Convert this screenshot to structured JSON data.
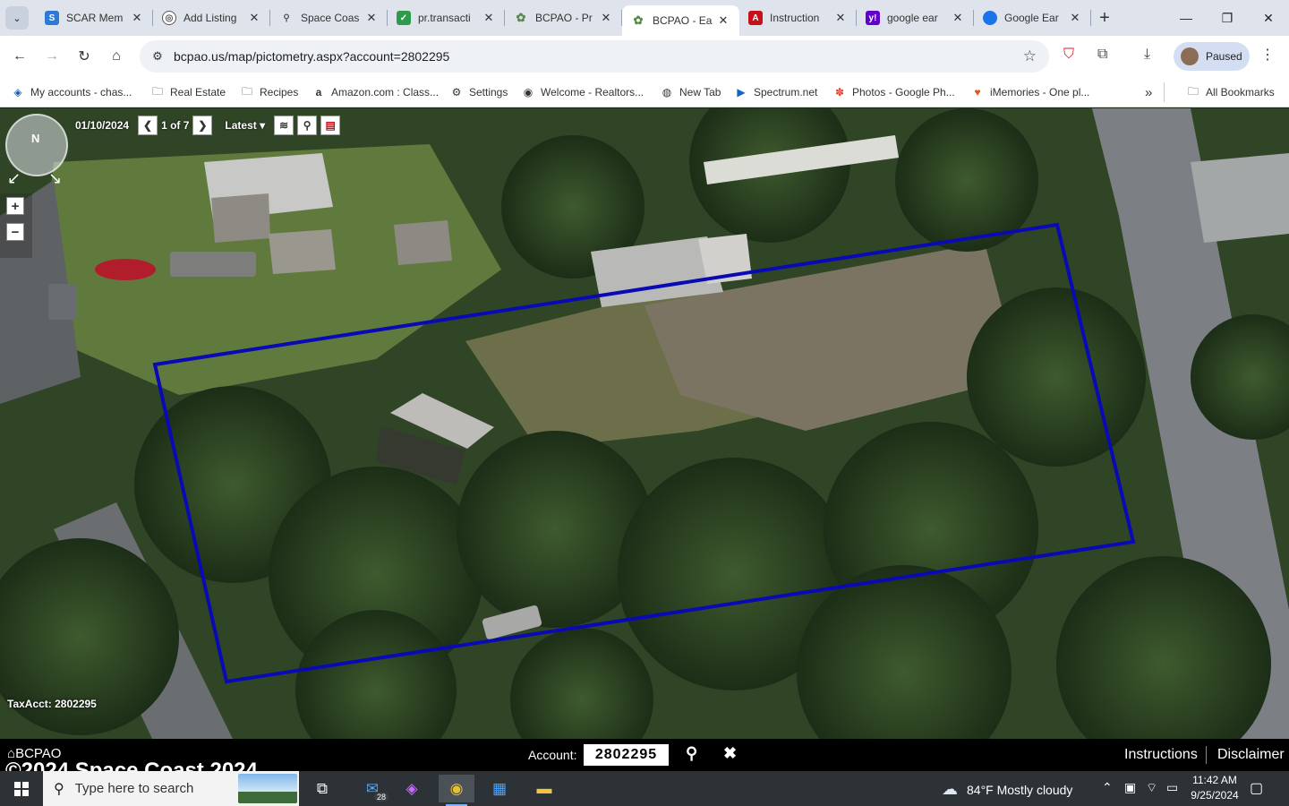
{
  "tabs": [
    {
      "title": "SCAR Mem",
      "favicon": "scar-icon",
      "color": "#2b7bd6"
    },
    {
      "title": "Add Listing",
      "favicon": "compass-icon",
      "color": "#555555"
    },
    {
      "title": "Space Coas",
      "favicon": "pin-icon",
      "color": "#555555"
    },
    {
      "title": "pr.transacti",
      "favicon": "transaction-icon",
      "color": "#2e9b4c"
    },
    {
      "title": "BCPAO - Pr",
      "favicon": "bcpao-icon",
      "color": "#5a8a4a"
    },
    {
      "title": "BCPAO - Ea",
      "favicon": "bcpao-icon",
      "color": "#5a8a4a"
    },
    {
      "title": "Instruction",
      "favicon": "pdf-icon",
      "color": "#c8101a"
    },
    {
      "title": "google ear",
      "favicon": "yahoo-icon",
      "color": "#6001d2"
    },
    {
      "title": "Google Ear",
      "favicon": "earth-icon",
      "color": "#1a73e8"
    }
  ],
  "address": {
    "url": "bcpao.us/map/pictometry.aspx?account=2802295"
  },
  "profile": {
    "label": "Paused"
  },
  "bookmarks": [
    {
      "label": "My accounts - chas...",
      "icon": "chase-icon"
    },
    {
      "label": "Real Estate",
      "icon": "folder-icon"
    },
    {
      "label": "Recipes",
      "icon": "folder-icon"
    },
    {
      "label": "Amazon.com : Class...",
      "icon": "amazon-icon"
    },
    {
      "label": "Settings",
      "icon": "gear-icon"
    },
    {
      "label": "Welcome - Realtors...",
      "icon": "realtors-icon"
    },
    {
      "label": "New Tab",
      "icon": "globe-icon"
    },
    {
      "label": "Spectrum.net",
      "icon": "spectrum-icon"
    },
    {
      "label": "Photos - Google Ph...",
      "icon": "photos-icon"
    },
    {
      "label": "iMemories - One pl...",
      "icon": "heart-icon"
    }
  ],
  "bookmarks_overflow": "»",
  "all_bookmarks": "All Bookmarks",
  "map": {
    "date": "01/10/2024",
    "page": "1 of 7",
    "latest_label": "Latest",
    "compass_label": "N",
    "zoom_in": "+",
    "zoom_out": "−",
    "taxacct": "TaxAcct: 2802295",
    "parcel_outline_color": "#0a0ab4"
  },
  "account_bar": {
    "brand": "BCPAO",
    "copyright": "©2024 Space Coast  2024",
    "account_label": "Account:",
    "account_value": "2802295",
    "instructions": "Instructions",
    "disclaimer": "Disclaimer"
  },
  "taskbar": {
    "search_placeholder": "Type here to search",
    "mail_badge": "28",
    "weather": "84°F  Mostly cloudy",
    "time": "11:42 AM",
    "date": "9/25/2024"
  }
}
